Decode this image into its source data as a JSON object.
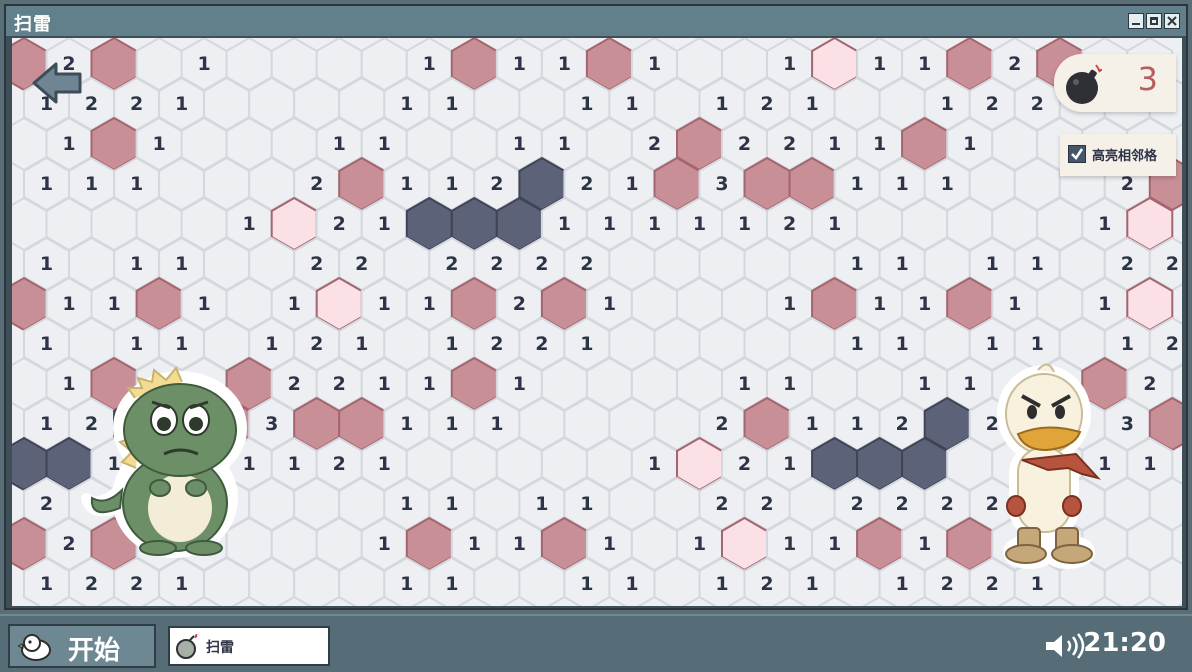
{
  "window": {
    "title": "扫雷"
  },
  "hud": {
    "mine_count": "3",
    "highlight_label": "高亮相邻格",
    "highlight_checked": true
  },
  "taskbar": {
    "start_label": "开始",
    "task_label": "扫雷",
    "clock": "21:20"
  },
  "colors": {
    "mine": "#c98f96",
    "revealed_mine": "#fbe1e6",
    "flag": "#5c6378",
    "board": "#edeff2"
  },
  "board": {
    "rows": [
      [
        "m",
        "2",
        "m",
        ".",
        "1",
        ".",
        ".",
        ".",
        ".",
        "1",
        "m",
        "1",
        "1",
        "m",
        "1",
        ".",
        ".",
        "1",
        "p",
        "1",
        "1",
        "m",
        "2",
        "m",
        "1",
        "."
      ],
      [
        "1",
        "2",
        "2",
        "1",
        ".",
        ".",
        ".",
        ".",
        "1",
        "1",
        ".",
        ".",
        "1",
        "1",
        ".",
        "1",
        "2",
        "1",
        ".",
        ".",
        "1",
        "2",
        "2",
        "1",
        ".",
        "."
      ],
      [
        ".",
        "1",
        "m",
        "1",
        ".",
        ".",
        ".",
        "1",
        "1",
        ".",
        ".",
        "1",
        "1",
        ".",
        "2",
        "m",
        "2",
        "2",
        "1",
        "1",
        "m",
        "1",
        ".",
        ".",
        ".",
        "."
      ],
      [
        "1",
        "1",
        "1",
        ".",
        ".",
        ".",
        "2",
        "m",
        "1",
        "1",
        "2",
        "f",
        "2",
        "1",
        "m",
        "3",
        "m",
        "m",
        "1",
        "1",
        "1",
        ".",
        ".",
        ".",
        "2",
        "m"
      ],
      [
        ".",
        ".",
        ".",
        ".",
        ".",
        "1",
        "p",
        "2",
        "1",
        "f",
        "f",
        "f",
        "1",
        "1",
        "1",
        "1",
        "1",
        "2",
        "1",
        ".",
        ".",
        ".",
        ".",
        ".",
        "1",
        "p"
      ],
      [
        "1",
        ".",
        "1",
        "1",
        ".",
        ".",
        "2",
        "2",
        ".",
        "2",
        "2",
        "2",
        "2",
        ".",
        ".",
        ".",
        ".",
        ".",
        "1",
        "1",
        ".",
        "1",
        "1",
        ".",
        "2",
        "2"
      ],
      [
        "m",
        "1",
        "1",
        "m",
        "1",
        ".",
        "1",
        "p",
        "1",
        "1",
        "m",
        "2",
        "m",
        "1",
        ".",
        ".",
        ".",
        "1",
        "m",
        "1",
        "1",
        "m",
        "1",
        ".",
        "1",
        "p"
      ],
      [
        "1",
        ".",
        "1",
        "1",
        ".",
        "1",
        "2",
        "1",
        ".",
        "1",
        "2",
        "2",
        "1",
        ".",
        ".",
        ".",
        ".",
        ".",
        "1",
        "1",
        ".",
        "1",
        "1",
        ".",
        "1",
        "2",
        "1"
      ],
      [
        ".",
        "1",
        "m",
        "1",
        "2",
        "m",
        "2",
        "2",
        "1",
        "1",
        "m",
        "1",
        ".",
        ".",
        ".",
        ".",
        "1",
        "1",
        ".",
        ".",
        "1",
        "1",
        ".",
        ".",
        "m",
        "2",
        "."
      ],
      [
        "1",
        "2",
        "f",
        "2",
        "m",
        "3",
        "m",
        "m",
        "1",
        "1",
        "1",
        ".",
        ".",
        ".",
        ".",
        "2",
        "m",
        "1",
        "1",
        "2",
        "f",
        "2",
        ".",
        ".",
        "3",
        "m"
      ],
      [
        "f",
        "f",
        "1",
        ".",
        "1",
        "1",
        "1",
        "2",
        "1",
        ".",
        ".",
        ".",
        ".",
        ".",
        "1",
        "p",
        "2",
        "1",
        "f",
        "f",
        "f",
        ".",
        ".",
        ".",
        "1",
        "1"
      ],
      [
        "2",
        "2",
        "2",
        ".",
        ".",
        ".",
        ".",
        ".",
        "1",
        "1",
        ".",
        "1",
        "1",
        ".",
        ".",
        "2",
        "2",
        ".",
        "2",
        "2",
        "2",
        "2",
        ".",
        ".",
        ".",
        "."
      ],
      [
        "m",
        "2",
        "m",
        ".",
        ".",
        ".",
        ".",
        ".",
        "1",
        "m",
        "1",
        "1",
        "m",
        "1",
        ".",
        "1",
        "p",
        "1",
        "1",
        "m",
        "1",
        "m",
        ".",
        ".",
        ".",
        "."
      ],
      [
        "1",
        "2",
        "2",
        "1",
        ".",
        ".",
        ".",
        ".",
        "1",
        "1",
        ".",
        ".",
        "1",
        "1",
        ".",
        "1",
        "2",
        "1",
        ".",
        "1",
        "2",
        "2",
        "1",
        ".",
        ".",
        "."
      ]
    ]
  }
}
